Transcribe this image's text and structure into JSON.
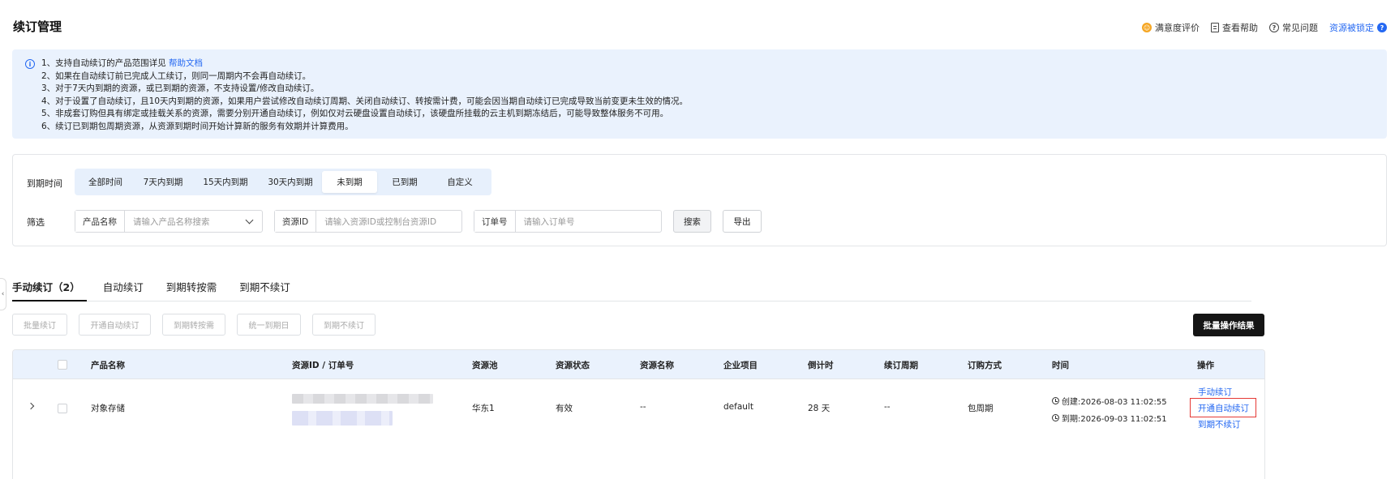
{
  "header": {
    "title": "续订管理",
    "links": [
      {
        "label": "满意度评价",
        "icon": "smile-icon"
      },
      {
        "label": "查看帮助",
        "icon": "doc-icon"
      },
      {
        "label": "常见问题",
        "icon": "question-icon"
      },
      {
        "label": "资源被锁定",
        "icon": "lock-info-icon"
      }
    ]
  },
  "notice": {
    "line1_text": "1、支持自动续订的产品范围详见",
    "line1_link": "帮助文档",
    "lines": [
      "2、如果在自动续订前已完成人工续订，则同一周期内不会再自动续订。",
      "3、对于7天内到期的资源，或已到期的资源，不支持设置/修改自动续订。",
      "4、对于设置了自动续订，且10天内到期的资源，如果用户尝试修改自动续订周期、关闭自动续订、转按需计费，可能会因当期自动续订已完成导致当前变更未生效的情况。",
      "5、非成套订购但具有绑定或挂载关系的资源，需要分别开通自动续订，例如仅对云硬盘设置自动续订，该硬盘所挂载的云主机到期冻结后，可能导致整体服务不可用。",
      "6、续订已到期包周期资源，从资源到期时间开始计算新的服务有效期并计算费用。"
    ]
  },
  "filter": {
    "expire_label": "到期时间",
    "segments": [
      "全部时间",
      "7天内到期",
      "15天内到期",
      "30天内到期",
      "未到期",
      "已到期",
      "自定义"
    ],
    "active_segment": "未到期",
    "screen_label": "筛选",
    "product_label": "产品名称",
    "product_placeholder": "请输入产品名称搜索",
    "resource_label": "资源ID",
    "resource_placeholder": "请输入资源ID或控制台资源ID",
    "order_label": "订单号",
    "order_placeholder": "请输入订单号",
    "search_button": "搜索",
    "export_button": "导出"
  },
  "tabs": [
    {
      "label": "手动续订（2）",
      "active": true
    },
    {
      "label": "自动续订",
      "active": false
    },
    {
      "label": "到期转按需",
      "active": false
    },
    {
      "label": "到期不续订",
      "active": false
    }
  ],
  "actions": {
    "batch_renew": "批量续订",
    "enable_auto": "开通自动续订",
    "to_ondemand": "到期转按需",
    "unify_date": "统一到期日",
    "no_renew": "到期不续订",
    "batch_result": "批量操作结果"
  },
  "table": {
    "headers": [
      "产品名称",
      "资源ID / 订单号",
      "资源池",
      "资源状态",
      "资源名称",
      "企业项目",
      "倒计时",
      "续订周期",
      "订购方式",
      "时间",
      "操作"
    ],
    "rows": [
      {
        "product": "对象存储",
        "pool": "华东1",
        "status": "有效",
        "name": "--",
        "project": "default",
        "countdown": "28 天",
        "period": "--",
        "method": "包周期",
        "created": "创建:2026-08-03 11:02:55",
        "expires": "到期:2026-09-03 11:02:51",
        "ops": [
          "手动续订",
          "开通自动续订",
          "到期不续订"
        ]
      }
    ]
  },
  "colors": {
    "accent": "#2468f2",
    "notice_bg": "#eaf2fd",
    "highlight": "#e53935",
    "dark_button": "#151515"
  }
}
